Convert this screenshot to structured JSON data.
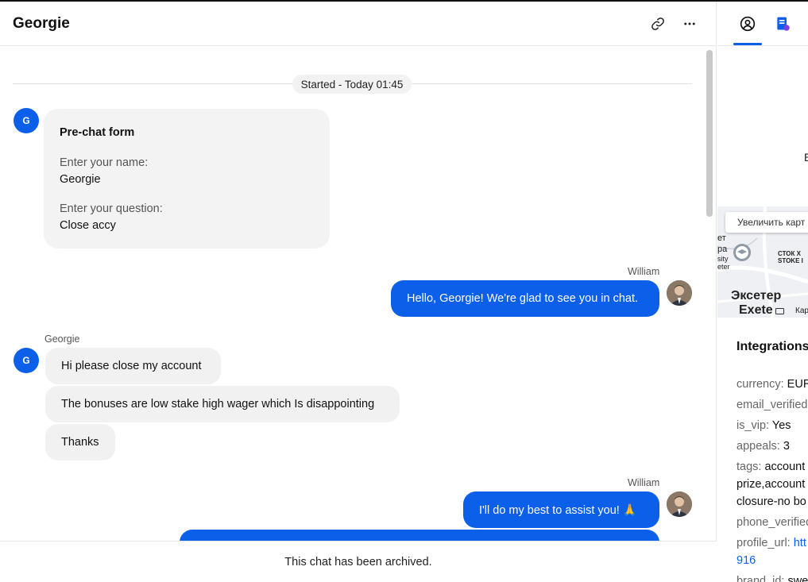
{
  "header": {
    "title": "Georgie",
    "link_icon": "link-icon",
    "more_icon": "more-horizontal-icon"
  },
  "thread": {
    "started": "Started - Today 01:45",
    "visitor_initial": "G",
    "prechat": {
      "title": "Pre-chat form",
      "name_label": "Enter your name:",
      "name_value": "Georgie",
      "question_label": "Enter your question:",
      "question_value": "Close accy"
    },
    "agent_name": "William",
    "visitor_name": "Georgie",
    "messages": [
      {
        "from": "agent",
        "text": "Hello, Georgie! We're glad to see you in chat."
      },
      {
        "from": "visitor",
        "text": "Hi please close my account"
      },
      {
        "from": "visitor",
        "text": "The bonuses are low stake high wager which Is disappointing"
      },
      {
        "from": "visitor",
        "text": "Thanks"
      },
      {
        "from": "agent",
        "text": "I'll do my best to assist you! 🙏"
      }
    ]
  },
  "footer": {
    "text": "This chat has been archived."
  },
  "sidebar": {
    "tabs": [
      {
        "name": "customer-details",
        "icon": "user-circle-icon",
        "active": true
      },
      {
        "name": "notes",
        "icon": "document-icon",
        "active": false
      }
    ],
    "partial_text": "E",
    "map": {
      "zoom_button": "Увеличить карт",
      "labels": [
        "ет",
        "ра",
        "sity",
        "eter",
        "СТОК Х",
        "STOKE I",
        "Эксетер",
        "Exete",
        "Кар"
      ]
    },
    "integrations_title": "Integrations",
    "fields": [
      {
        "key": "currency:",
        "value": "EUR"
      },
      {
        "key": "email_verified",
        "value": ""
      },
      {
        "key": "is_vip:",
        "value": "Yes"
      },
      {
        "key": "appeals:",
        "value": "3"
      },
      {
        "key": "tags:",
        "value": "account",
        "line2": "prize,account",
        "line3": "closure-no bo"
      },
      {
        "key": "phone_verified",
        "value": ""
      },
      {
        "key": "profile_url:",
        "value": "htt",
        "line2": "916"
      },
      {
        "key": "brand_id:",
        "value": "swe"
      }
    ]
  },
  "colors": {
    "accent": "#0b5fe8",
    "bubble_in": "#f1f1f1",
    "card": "#f3f3f3"
  }
}
